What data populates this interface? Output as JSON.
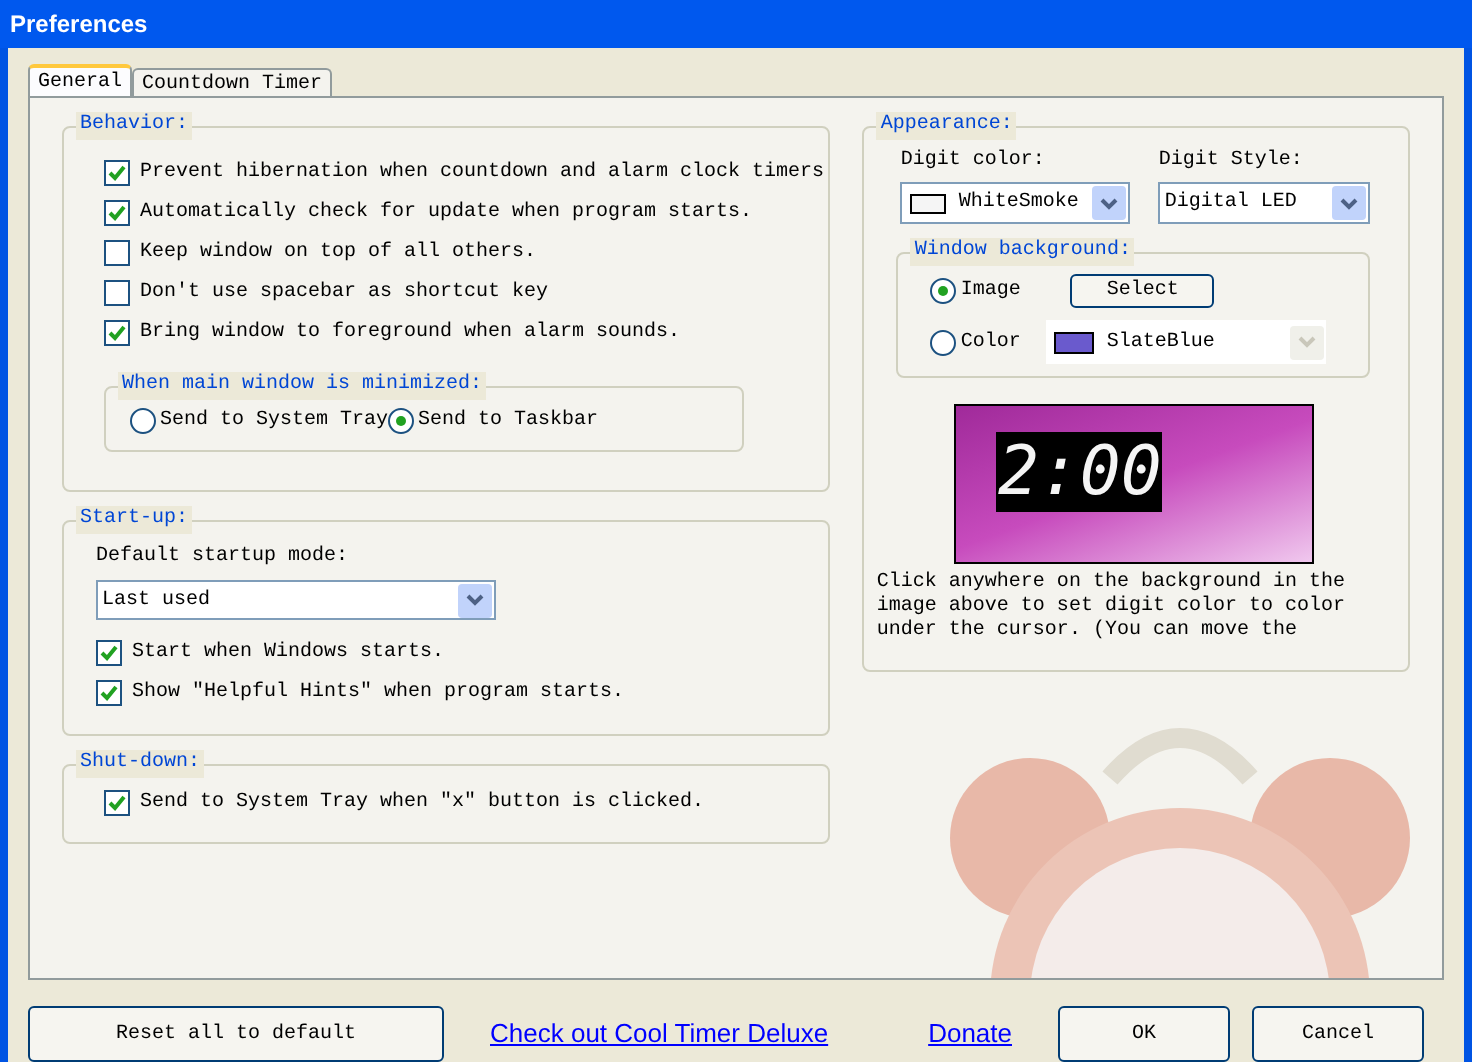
{
  "window": {
    "title": "Preferences"
  },
  "tabs": [
    {
      "label": "General",
      "selected": true
    },
    {
      "label": "Countdown Timer",
      "selected": false
    }
  ],
  "behavior": {
    "title": "Behavior:",
    "options": [
      {
        "label": "Prevent hibernation when countdown and alarm clock timers",
        "checked": true
      },
      {
        "label": "Automatically check for update when program starts.",
        "checked": true
      },
      {
        "label": "Keep window on top of all others.",
        "checked": false
      },
      {
        "label": "Don't use spacebar as shortcut key",
        "checked": false
      },
      {
        "label": "Bring window to foreground when alarm sounds.",
        "checked": true
      }
    ],
    "minimized": {
      "title": "When main window is minimized:",
      "options": [
        {
          "label": "Send to System Tray",
          "selected": false
        },
        {
          "label": "Send to Taskbar",
          "selected": true
        }
      ]
    }
  },
  "startup": {
    "title": "Start-up:",
    "mode_label": "Default startup mode:",
    "mode_value": "Last used",
    "options": [
      {
        "label": "Start when Windows starts.",
        "checked": true
      },
      {
        "label": "Show \"Helpful Hints\" when program starts.",
        "checked": true
      }
    ]
  },
  "shutdown": {
    "title": "Shut-down:",
    "options": [
      {
        "label": "Send to System Tray when \"x\" button is clicked.",
        "checked": true
      }
    ]
  },
  "appearance": {
    "title": "Appearance:",
    "digit_color_label": "Digit color:",
    "digit_color": {
      "value": "WhiteSmoke",
      "color": "#f5f5f5"
    },
    "digit_style_label": "Digit Style:",
    "digit_style": "Digital LED",
    "background": {
      "title": "Window background:",
      "options": [
        {
          "kind": "image",
          "label": "Image",
          "selected": true,
          "button": "Select"
        },
        {
          "kind": "color",
          "label": "Color",
          "selected": false,
          "value": "SlateBlue",
          "color": "#6a5acd"
        }
      ]
    },
    "preview_time": "2:00",
    "hint": "Click anywhere on the background in the image above to set digit color to color under the cursor. (You can move the"
  },
  "buttons": {
    "reset": "Reset all to default",
    "links": [
      "Check out Cool Timer Deluxe",
      "Donate"
    ],
    "ok": "OK",
    "cancel": "Cancel"
  }
}
